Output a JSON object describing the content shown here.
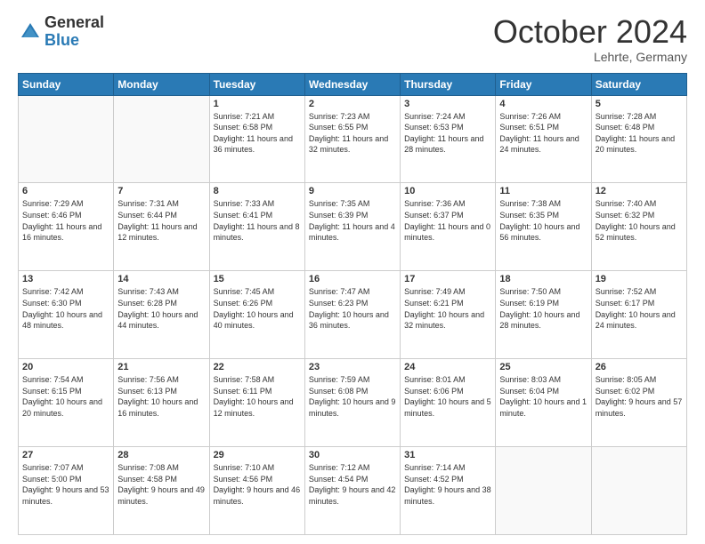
{
  "header": {
    "logo_general": "General",
    "logo_blue": "Blue",
    "month": "October 2024",
    "location": "Lehrte, Germany"
  },
  "days_of_week": [
    "Sunday",
    "Monday",
    "Tuesday",
    "Wednesday",
    "Thursday",
    "Friday",
    "Saturday"
  ],
  "weeks": [
    [
      {
        "day": "",
        "info": ""
      },
      {
        "day": "",
        "info": ""
      },
      {
        "day": "1",
        "info": "Sunrise: 7:21 AM\nSunset: 6:58 PM\nDaylight: 11 hours and 36 minutes."
      },
      {
        "day": "2",
        "info": "Sunrise: 7:23 AM\nSunset: 6:55 PM\nDaylight: 11 hours and 32 minutes."
      },
      {
        "day": "3",
        "info": "Sunrise: 7:24 AM\nSunset: 6:53 PM\nDaylight: 11 hours and 28 minutes."
      },
      {
        "day": "4",
        "info": "Sunrise: 7:26 AM\nSunset: 6:51 PM\nDaylight: 11 hours and 24 minutes."
      },
      {
        "day": "5",
        "info": "Sunrise: 7:28 AM\nSunset: 6:48 PM\nDaylight: 11 hours and 20 minutes."
      }
    ],
    [
      {
        "day": "6",
        "info": "Sunrise: 7:29 AM\nSunset: 6:46 PM\nDaylight: 11 hours and 16 minutes."
      },
      {
        "day": "7",
        "info": "Sunrise: 7:31 AM\nSunset: 6:44 PM\nDaylight: 11 hours and 12 minutes."
      },
      {
        "day": "8",
        "info": "Sunrise: 7:33 AM\nSunset: 6:41 PM\nDaylight: 11 hours and 8 minutes."
      },
      {
        "day": "9",
        "info": "Sunrise: 7:35 AM\nSunset: 6:39 PM\nDaylight: 11 hours and 4 minutes."
      },
      {
        "day": "10",
        "info": "Sunrise: 7:36 AM\nSunset: 6:37 PM\nDaylight: 11 hours and 0 minutes."
      },
      {
        "day": "11",
        "info": "Sunrise: 7:38 AM\nSunset: 6:35 PM\nDaylight: 10 hours and 56 minutes."
      },
      {
        "day": "12",
        "info": "Sunrise: 7:40 AM\nSunset: 6:32 PM\nDaylight: 10 hours and 52 minutes."
      }
    ],
    [
      {
        "day": "13",
        "info": "Sunrise: 7:42 AM\nSunset: 6:30 PM\nDaylight: 10 hours and 48 minutes."
      },
      {
        "day": "14",
        "info": "Sunrise: 7:43 AM\nSunset: 6:28 PM\nDaylight: 10 hours and 44 minutes."
      },
      {
        "day": "15",
        "info": "Sunrise: 7:45 AM\nSunset: 6:26 PM\nDaylight: 10 hours and 40 minutes."
      },
      {
        "day": "16",
        "info": "Sunrise: 7:47 AM\nSunset: 6:23 PM\nDaylight: 10 hours and 36 minutes."
      },
      {
        "day": "17",
        "info": "Sunrise: 7:49 AM\nSunset: 6:21 PM\nDaylight: 10 hours and 32 minutes."
      },
      {
        "day": "18",
        "info": "Sunrise: 7:50 AM\nSunset: 6:19 PM\nDaylight: 10 hours and 28 minutes."
      },
      {
        "day": "19",
        "info": "Sunrise: 7:52 AM\nSunset: 6:17 PM\nDaylight: 10 hours and 24 minutes."
      }
    ],
    [
      {
        "day": "20",
        "info": "Sunrise: 7:54 AM\nSunset: 6:15 PM\nDaylight: 10 hours and 20 minutes."
      },
      {
        "day": "21",
        "info": "Sunrise: 7:56 AM\nSunset: 6:13 PM\nDaylight: 10 hours and 16 minutes."
      },
      {
        "day": "22",
        "info": "Sunrise: 7:58 AM\nSunset: 6:11 PM\nDaylight: 10 hours and 12 minutes."
      },
      {
        "day": "23",
        "info": "Sunrise: 7:59 AM\nSunset: 6:08 PM\nDaylight: 10 hours and 9 minutes."
      },
      {
        "day": "24",
        "info": "Sunrise: 8:01 AM\nSunset: 6:06 PM\nDaylight: 10 hours and 5 minutes."
      },
      {
        "day": "25",
        "info": "Sunrise: 8:03 AM\nSunset: 6:04 PM\nDaylight: 10 hours and 1 minute."
      },
      {
        "day": "26",
        "info": "Sunrise: 8:05 AM\nSunset: 6:02 PM\nDaylight: 9 hours and 57 minutes."
      }
    ],
    [
      {
        "day": "27",
        "info": "Sunrise: 7:07 AM\nSunset: 5:00 PM\nDaylight: 9 hours and 53 minutes."
      },
      {
        "day": "28",
        "info": "Sunrise: 7:08 AM\nSunset: 4:58 PM\nDaylight: 9 hours and 49 minutes."
      },
      {
        "day": "29",
        "info": "Sunrise: 7:10 AM\nSunset: 4:56 PM\nDaylight: 9 hours and 46 minutes."
      },
      {
        "day": "30",
        "info": "Sunrise: 7:12 AM\nSunset: 4:54 PM\nDaylight: 9 hours and 42 minutes."
      },
      {
        "day": "31",
        "info": "Sunrise: 7:14 AM\nSunset: 4:52 PM\nDaylight: 9 hours and 38 minutes."
      },
      {
        "day": "",
        "info": ""
      },
      {
        "day": "",
        "info": ""
      }
    ]
  ]
}
